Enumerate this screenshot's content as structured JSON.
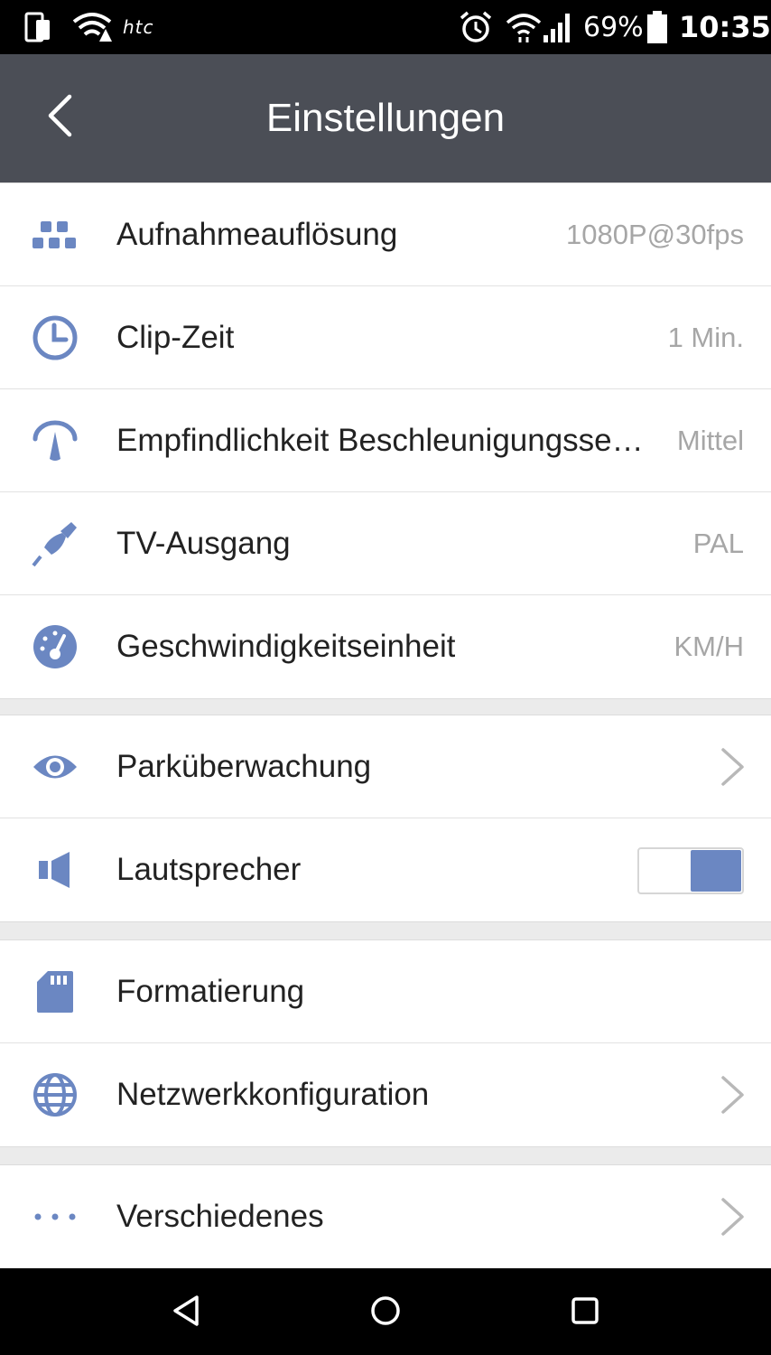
{
  "statusbar": {
    "brand": "htc",
    "battery_pct": "69%",
    "time": "10:35"
  },
  "appbar": {
    "title": "Einstellungen"
  },
  "colors": {
    "accent": "#6b87c2",
    "appbar": "#4b4e56",
    "value_text": "#a6a6a6"
  },
  "groups": [
    {
      "items": [
        {
          "icon": "resolution-grid-icon",
          "label": "Aufnahmeauflösung",
          "value": "1080P@30fps"
        },
        {
          "icon": "clock-icon",
          "label": "Clip-Zeit",
          "value": "1 Min."
        },
        {
          "icon": "sensor-gauge-icon",
          "label": "Empfindlichkeit Beschleunigungssensor",
          "value": "Mittel"
        },
        {
          "icon": "cable-plug-icon",
          "label": "TV-Ausgang",
          "value": "PAL"
        },
        {
          "icon": "speedometer-icon",
          "label": "Geschwindigkeitseinheit",
          "value": "KM/H"
        }
      ]
    },
    {
      "items": [
        {
          "icon": "eye-icon",
          "label": "Parküberwachung",
          "control": "chevron"
        },
        {
          "icon": "speaker-icon",
          "label": "Lautsprecher",
          "control": "toggle",
          "toggle_on": true
        }
      ]
    },
    {
      "items": [
        {
          "icon": "sd-card-icon",
          "label": "Formatierung"
        },
        {
          "icon": "globe-icon",
          "label": "Netzwerkkonfiguration",
          "control": "chevron"
        }
      ]
    },
    {
      "items": [
        {
          "icon": "more-dots-icon",
          "label": "Verschiedenes",
          "control": "chevron"
        }
      ]
    }
  ]
}
